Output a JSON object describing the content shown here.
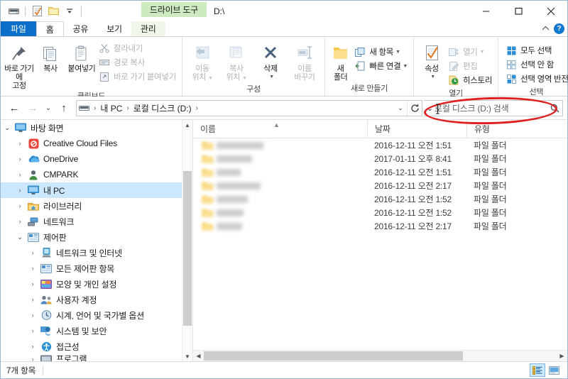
{
  "window": {
    "title": "D:\\",
    "contextual_tab_title": "드라이브 도구",
    "quick_access": [
      {
        "name": "drive-icon",
        "label": "드라이브"
      },
      {
        "name": "properties-icon",
        "label": "속성"
      },
      {
        "name": "new-folder-icon",
        "label": "새 폴더"
      },
      {
        "name": "customize-qat-icon",
        "label": "빠른 실행 도구 모음 사용자 지정"
      }
    ],
    "caption": {
      "minimize": "─",
      "maximize": "□",
      "close": "✕"
    },
    "ribbon_collapse": "리본 축소",
    "help": "?"
  },
  "tabs": [
    {
      "label": "파일",
      "state": "file"
    },
    {
      "label": "홈",
      "state": "active"
    },
    {
      "label": "공유",
      "state": "normal"
    },
    {
      "label": "보기",
      "state": "normal"
    },
    {
      "label": "관리",
      "state": "contextual"
    }
  ],
  "ribbon": {
    "groups": [
      {
        "label": "클립보드",
        "big": [
          {
            "label_line1": "바로 가기에",
            "label_line2": "고정",
            "icon": "pin-icon",
            "disabled": false
          },
          {
            "label_line1": "복사",
            "label_line2": "",
            "icon": "copy-icon",
            "disabled": false
          },
          {
            "label_line1": "붙여넣기",
            "label_line2": "",
            "icon": "paste-icon",
            "disabled": false
          }
        ],
        "small": [
          {
            "label": "잘라내기",
            "icon": "scissors-icon",
            "disabled": true
          },
          {
            "label": "경로 복사",
            "icon": "copy-path-icon",
            "disabled": true
          },
          {
            "label": "바로 가기 붙여넣기",
            "icon": "paste-shortcut-icon",
            "disabled": true
          }
        ]
      },
      {
        "label": "구성",
        "big": [
          {
            "label_line1": "이동",
            "label_line2": "위치",
            "icon": "move-to-icon",
            "disabled": true,
            "dropdown": true
          },
          {
            "label_line1": "복사",
            "label_line2": "위치",
            "icon": "copy-to-icon",
            "disabled": true,
            "dropdown": true
          },
          {
            "label_line1": "삭제",
            "label_line2": "",
            "icon": "delete-x-icon",
            "disabled": false,
            "dropdown": true
          },
          {
            "label_line1": "이름",
            "label_line2": "바꾸기",
            "icon": "rename-icon",
            "disabled": true
          }
        ],
        "small": []
      },
      {
        "label": "새로 만들기",
        "big": [
          {
            "label_line1": "새",
            "label_line2": "폴더",
            "icon": "new-folder-icon",
            "disabled": false
          }
        ],
        "small": [
          {
            "label": "새 항목",
            "icon": "new-item-icon",
            "disabled": false,
            "dropdown": true
          },
          {
            "label": "빠른 연결",
            "icon": "easy-access-icon",
            "disabled": false,
            "dropdown": true
          }
        ]
      },
      {
        "label": "열기",
        "big": [
          {
            "label_line1": "속성",
            "label_line2": "",
            "icon": "properties-icon",
            "disabled": false,
            "dropdown": true
          }
        ],
        "small": [
          {
            "label": "열기",
            "icon": "open-icon",
            "disabled": true,
            "dropdown": true
          },
          {
            "label": "편집",
            "icon": "edit-icon",
            "disabled": true
          },
          {
            "label": "히스토리",
            "icon": "history-icon",
            "disabled": false
          }
        ]
      },
      {
        "label": "선택",
        "big": [],
        "small": [
          {
            "label": "모두 선택",
            "icon": "select-all-icon",
            "disabled": false
          },
          {
            "label": "선택 안 함",
            "icon": "select-none-icon",
            "disabled": false
          },
          {
            "label": "선택 영역 반전",
            "icon": "invert-selection-icon",
            "disabled": false
          }
        ]
      }
    ]
  },
  "address": {
    "back": "←",
    "forward": "→",
    "recent": "⌄",
    "up": "↑",
    "crumbs": [
      "내 PC",
      "로컬 디스크 (D:)"
    ],
    "drive_icon": "drive-icon",
    "separator": "›",
    "dropdown": "⌄",
    "refresh": "↻"
  },
  "search": {
    "placeholder": "로컬 디스크 (D:) 검색",
    "icon": "magnifier-icon",
    "dropdown_caret": "⌄"
  },
  "navpane": {
    "items": [
      {
        "label": "바탕 화면",
        "depth": 0,
        "expander": "open",
        "icon": "desktop-icon",
        "selected": false
      },
      {
        "label": "Creative Cloud Files",
        "depth": 1,
        "expander": "closed",
        "icon": "creative-cloud-icon",
        "selected": false
      },
      {
        "label": "OneDrive",
        "depth": 1,
        "expander": "closed",
        "icon": "onedrive-icon",
        "selected": false
      },
      {
        "label": "CMPARK",
        "depth": 1,
        "expander": "closed",
        "icon": "user-icon",
        "selected": false
      },
      {
        "label": "내 PC",
        "depth": 1,
        "expander": "closed",
        "icon": "this-pc-icon",
        "selected": true
      },
      {
        "label": "라이브러리",
        "depth": 1,
        "expander": "closed",
        "icon": "libraries-icon",
        "selected": false
      },
      {
        "label": "네트워크",
        "depth": 1,
        "expander": "closed",
        "icon": "network-icon",
        "selected": false
      },
      {
        "label": "제어판",
        "depth": 1,
        "expander": "open",
        "icon": "control-panel-icon",
        "selected": false
      },
      {
        "label": "네트워크 및 인터넷",
        "depth": 2,
        "expander": "closed",
        "icon": "network-internet-icon",
        "selected": false
      },
      {
        "label": "모든 제어판 항목",
        "depth": 2,
        "expander": "closed",
        "icon": "all-items-icon",
        "selected": false
      },
      {
        "label": "모양 및 개인 설정",
        "depth": 2,
        "expander": "closed",
        "icon": "appearance-icon",
        "selected": false
      },
      {
        "label": "사용자 계정",
        "depth": 2,
        "expander": "closed",
        "icon": "user-accounts-icon",
        "selected": false
      },
      {
        "label": "시계, 언어 및 국가별 옵션",
        "depth": 2,
        "expander": "closed",
        "icon": "clock-region-icon",
        "selected": false
      },
      {
        "label": "시스템 및 보안",
        "depth": 2,
        "expander": "closed",
        "icon": "system-security-icon",
        "selected": false
      },
      {
        "label": "접근성",
        "depth": 2,
        "expander": "closed",
        "icon": "ease-of-access-icon",
        "selected": false
      },
      {
        "label": "프로그램",
        "depth": 2,
        "expander": "closed",
        "icon": "programs-icon",
        "selected": false,
        "clipped": true
      }
    ]
  },
  "filelist": {
    "columns": [
      {
        "label": "이름",
        "sorted": true,
        "sort_dir": "asc"
      },
      {
        "label": "날짜",
        "sorted": false
      },
      {
        "label": "유형",
        "sorted": false
      }
    ],
    "rows": [
      {
        "name": "",
        "name_redacted": true,
        "name_width": 66,
        "date": "2016-12-11 오전 1:51",
        "type": "파일 폴더"
      },
      {
        "name": "",
        "name_redacted": true,
        "name_width": 50,
        "date": "2017-01-11 오후 8:41",
        "type": "파일 폴더"
      },
      {
        "name": "",
        "name_redacted": true,
        "name_width": 34,
        "date": "2016-12-11 오전 1:51",
        "type": "파일 폴더"
      },
      {
        "name": "",
        "name_redacted": true,
        "name_width": 62,
        "date": "2016-12-11 오전 2:17",
        "type": "파일 폴더"
      },
      {
        "name": "",
        "name_redacted": true,
        "name_width": 44,
        "date": "2016-12-11 오전 1:52",
        "type": "파일 폴더"
      },
      {
        "name": "",
        "name_redacted": true,
        "name_width": 38,
        "date": "2016-12-11 오전 1:52",
        "type": "파일 폴더"
      },
      {
        "name": "",
        "name_redacted": true,
        "name_width": 36,
        "date": "2016-12-11 오전 2:17",
        "type": "파일 폴더"
      }
    ]
  },
  "statusbar": {
    "item_count": "7개 항목",
    "views": [
      {
        "name": "details-view-button",
        "label": "자세히",
        "active": true
      },
      {
        "name": "large-icons-view-button",
        "label": "큰 아이콘",
        "active": false
      }
    ]
  },
  "annotation": {
    "shape": "ellipse",
    "color": "#e02020",
    "target": "search-box"
  },
  "colors": {
    "file_tab": "#0b6ec9",
    "contextual_tab": "#cdeac0",
    "selection": "#cce8ff",
    "annotation": "#e02020"
  }
}
